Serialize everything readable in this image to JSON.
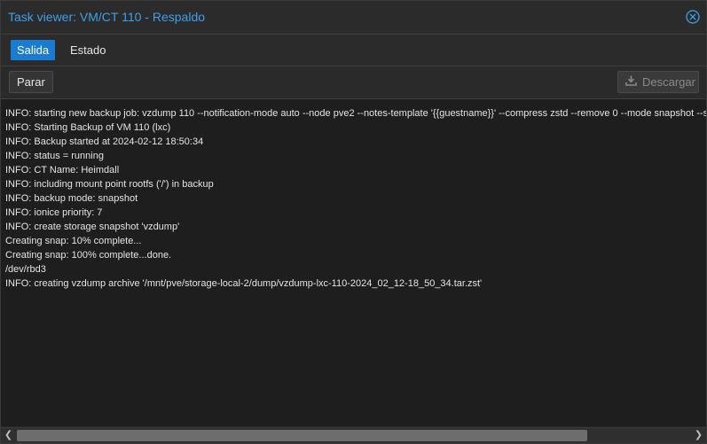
{
  "window": {
    "title": "Task viewer: VM/CT 110 - Respaldo"
  },
  "tabs": [
    {
      "label": "Salida",
      "active": true
    },
    {
      "label": "Estado",
      "active": false
    }
  ],
  "toolbar": {
    "stop_label": "Parar",
    "download_label": "Descargar",
    "download_enabled": false
  },
  "log": {
    "lines": [
      "INFO: starting new backup job: vzdump 110 --notification-mode auto --node pve2 --notes-template '{{guestname}}' --compress zstd --remove 0 --mode snapshot --s",
      "INFO: Starting Backup of VM 110 (lxc)",
      "INFO: Backup started at 2024-02-12 18:50:34",
      "INFO: status = running",
      "INFO: CT Name: Heimdall",
      "INFO: including mount point rootfs ('/') in backup",
      "INFO: backup mode: snapshot",
      "INFO: ionice priority: 7",
      "INFO: create storage snapshot 'vzdump'",
      "Creating snap: 10% complete...",
      "Creating snap: 100% complete...done.",
      "/dev/rbd3",
      "INFO: creating vzdump archive '/mnt/pve/storage-local-2/dump/vzdump-lxc-110-2024_02_12-18_50_34.tar.zst'"
    ]
  },
  "colors": {
    "accent": "#1a7bd0",
    "title": "#3fa0e8",
    "background": "#1e1e1e",
    "text": "#e4e4e4"
  },
  "icons": {
    "close": "close-circle-icon",
    "download": "download-icon",
    "scroll_left": "chevron-left-icon",
    "scroll_right": "chevron-right-icon"
  }
}
